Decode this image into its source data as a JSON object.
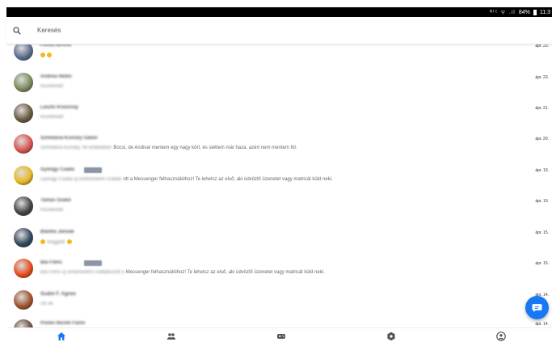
{
  "status_bar": {
    "icons": "ᴺᶠᶜ ᯤ .ıl",
    "battery": "84%",
    "time": "11:3"
  },
  "search": {
    "placeholder": "Keresés"
  },
  "conversations": [
    {
      "name": "Panka Bíróné",
      "snippet": "",
      "has_emoji": true,
      "date": "ápr. 23.",
      "avatar_color": "#5a6e8c"
    },
    {
      "name": "Andrea Helen",
      "snippet": "Kezelendő",
      "has_emoji": false,
      "date": "ápr. 23.",
      "avatar_color": "#7a8a5a"
    },
    {
      "name": "Laszlo Krasznay",
      "snippet": "Kezelendő",
      "has_emoji": false,
      "date": "ápr. 21.",
      "avatar_color": "#6b5a3e"
    },
    {
      "name": "Szmetana-Kunský Gábor",
      "snippet_blur": "Szmetana-Kunský: Mi érdekében",
      "snippet": "Bocsi, de Andival mentem egy nagy kört, és siettem már haza, azért nem mentem föl.",
      "has_emoji": false,
      "date": "ápr. 20.",
      "avatar_color": "#d9534f"
    },
    {
      "name": "Gyöngy Csaba",
      "badge": true,
      "snippet_blur": "Gyöngy Csaba új ismerősként csatlak",
      "snippet": "ott a Messenger felhasználóihoz! Te lehetsz az első, aki üdvözlő üzenetet vagy matricát küld neki.",
      "has_emoji": false,
      "date": "ápr. 19.",
      "avatar_color": "#e8b923"
    },
    {
      "name": "Tamás Szabó",
      "snippet": "Kezelendő",
      "has_emoji": false,
      "date": "ápr. 19.",
      "avatar_color": "#444"
    },
    {
      "name": "Blanka Jansák",
      "snippet": "Reggeltt",
      "has_emoji": true,
      "date": "ápr. 15.",
      "avatar_color": "#33475b"
    },
    {
      "name": "Bíá Films",
      "badge": true,
      "snippet_blur": "Bíá Films új ismerősként csatlakozott a",
      "snippet": "Messenger felhasználóihoz! Te lehetsz az első, aki üdvözlő üzenetet vagy matricát küld neki.",
      "has_emoji": false,
      "date": "ápr. 15.",
      "avatar_color": "#e84a1c"
    },
    {
      "name": "Szabó F. Ágnes",
      "snippet": "Ok ok",
      "has_emoji": false,
      "date": "ápr. 14.",
      "avatar_color": "#a0522d"
    },
    {
      "name": "Pusko Nicole Fanni",
      "snippet": "",
      "has_emoji": false,
      "date": "ápr. 14.",
      "avatar_color": "#6d4c41"
    }
  ],
  "nav": [
    {
      "icon": "home-icon",
      "active": true
    },
    {
      "icon": "people-icon",
      "active": false
    },
    {
      "icon": "games-icon",
      "active": false
    },
    {
      "icon": "discover-icon",
      "active": false
    },
    {
      "icon": "profile-icon",
      "active": false
    }
  ],
  "colors": {
    "accent": "#1877f2",
    "icon_gray": "#555555"
  }
}
